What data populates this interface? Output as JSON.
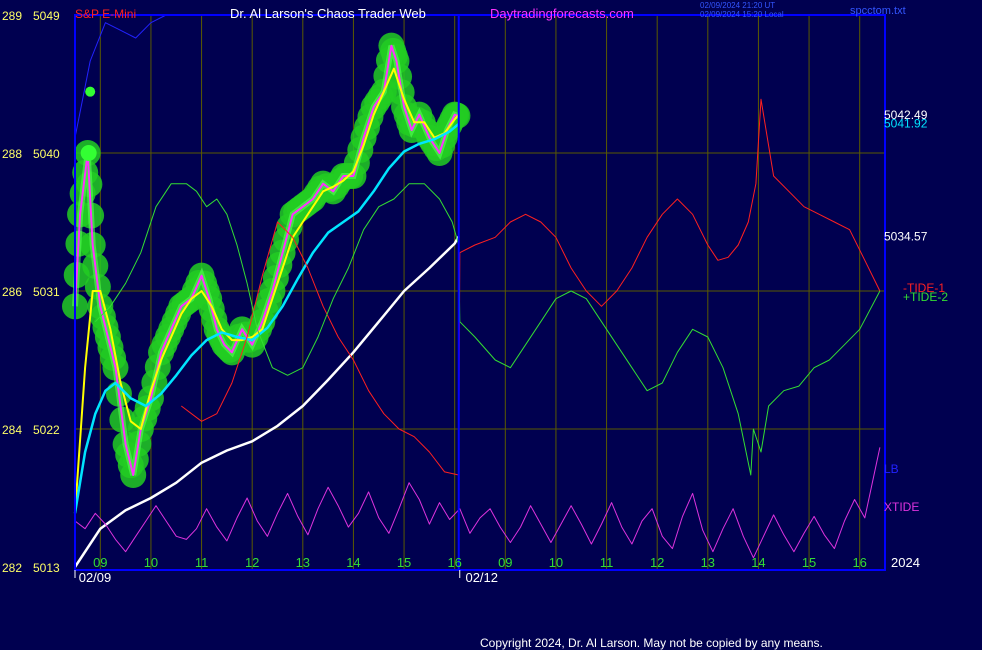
{
  "header": {
    "symbol": "S&P E-Mini",
    "author": "Dr. Al Larson's Chaos Trader Web",
    "site": "Daytradingforecasts.com",
    "stamp_utc": "02/09/2024 21:20 UT",
    "stamp_local": "02/09/2024 15:20 Local",
    "file": "spcctom.txt"
  },
  "footer": {
    "copyright": "Copyright 2024, Dr. Al Larson. May not be copied by any means."
  },
  "colors": {
    "background": "#000050",
    "frame": "#0000ff",
    "grid": "#5a5a00",
    "price": "#ff33ff",
    "fast_ma": "#ffff00",
    "mid_ma": "#00e5ff",
    "slow_ma": "#ffffff",
    "tide1": "#ff2020",
    "tide2": "#33dd33",
    "lb": "#2222ff",
    "xtide": "#dd33dd",
    "halo": "#22cc22"
  },
  "chart_data": {
    "type": "line",
    "y_axis": {
      "ylim": [
        5013,
        5049
      ],
      "ticks": [
        {
          "value": 5049,
          "label_left": "289",
          "label": "5049"
        },
        {
          "value": 5040,
          "label_left": "288",
          "label": "5040"
        },
        {
          "value": 5031,
          "label_left": "286",
          "label": "5031"
        },
        {
          "value": 5022,
          "label_left": "284",
          "label": "5022"
        },
        {
          "value": 5013,
          "label_left": "282",
          "label": "5013"
        }
      ]
    },
    "x_axis": {
      "range_hours": [
        8.5,
        24.5
      ],
      "hour_ticks": [
        {
          "x": 9,
          "label": "09"
        },
        {
          "x": 10,
          "label": "10"
        },
        {
          "x": 11,
          "label": "11"
        },
        {
          "x": 12,
          "label": "12"
        },
        {
          "x": 13,
          "label": "13"
        },
        {
          "x": 14,
          "label": "14"
        },
        {
          "x": 15,
          "label": "15"
        },
        {
          "x": 16,
          "label": "16"
        },
        {
          "x": 17,
          "label": "09"
        },
        {
          "x": 18,
          "label": "10"
        },
        {
          "x": 19,
          "label": "11"
        },
        {
          "x": 20,
          "label": "12"
        },
        {
          "x": 21,
          "label": "13"
        },
        {
          "x": 22,
          "label": "14"
        },
        {
          "x": 23,
          "label": "15"
        },
        {
          "x": 24,
          "label": "16"
        }
      ],
      "date_labels": [
        {
          "x": 8.5,
          "label": "02/09"
        },
        {
          "x": 16.1,
          "label": "02/12"
        }
      ],
      "year_label": "2024",
      "now_x": 16.08
    },
    "right_labels": [
      {
        "text": "5042.49",
        "value": 5042.49,
        "color": "#ffffff"
      },
      {
        "text": "5041.92",
        "value": 5041.92,
        "color": "#00e5ff"
      },
      {
        "text": "5034.57",
        "value": 5034.57,
        "color": "#ffffff"
      },
      {
        "text": "-TIDE-1",
        "value": 5031.2,
        "color": "#ff2020"
      },
      {
        "text": "+TIDE-2",
        "value": 5030.6,
        "color": "#33dd33"
      },
      {
        "text": "LB",
        "value": 5019.4,
        "color": "#2222ff"
      },
      {
        "text": "XTIDE",
        "value": 5016.9,
        "color": "#dd33dd"
      }
    ],
    "series": [
      {
        "name": "S&P E-Mini",
        "kind": "price",
        "x": [
          8.5,
          8.6,
          8.75,
          8.85,
          9.0,
          9.15,
          9.3,
          9.5,
          9.65,
          9.8,
          10.0,
          10.2,
          10.4,
          10.6,
          10.8,
          11.0,
          11.15,
          11.3,
          11.45,
          11.6,
          11.8,
          12.0,
          12.2,
          12.4,
          12.6,
          12.8,
          13.0,
          13.2,
          13.4,
          13.6,
          13.8,
          14.0,
          14.2,
          14.4,
          14.6,
          14.75,
          14.85,
          15.0,
          15.15,
          15.3,
          15.5,
          15.7,
          15.85,
          16.0,
          16.08
        ],
        "y": [
          5030,
          5036,
          5040,
          5034,
          5030,
          5028,
          5026,
          5021,
          5019,
          5022,
          5024,
          5027,
          5028.5,
          5030,
          5030.5,
          5032,
          5030.5,
          5028.5,
          5027.5,
          5027,
          5028.5,
          5027.5,
          5029,
          5031,
          5033.5,
          5036,
          5036.5,
          5037,
          5038,
          5037.5,
          5038.5,
          5038.5,
          5041,
          5043,
          5044,
          5047,
          5046,
          5043,
          5041.5,
          5042.5,
          5041,
          5040,
          5041.5,
          5042.5,
          5042.4
        ]
      },
      {
        "name": "",
        "kind": "fast_ma",
        "x": [
          8.5,
          8.7,
          8.85,
          9.0,
          9.2,
          9.4,
          9.6,
          9.8,
          10.0,
          10.2,
          10.4,
          10.6,
          10.8,
          11.0,
          11.2,
          11.4,
          11.6,
          11.8,
          12.0,
          12.2,
          12.4,
          12.6,
          12.8,
          13.0,
          13.2,
          13.4,
          13.6,
          13.8,
          14.0,
          14.2,
          14.4,
          14.6,
          14.8,
          15.0,
          15.2,
          15.4,
          15.6,
          15.8,
          16.0,
          16.08
        ],
        "y": [
          5016.5,
          5026,
          5031,
          5031,
          5028.5,
          5025,
          5022.5,
          5022,
          5024.5,
          5026.5,
          5028,
          5029.5,
          5030.5,
          5031,
          5030,
          5028.5,
          5027.8,
          5027.8,
          5028,
          5028.5,
          5030.5,
          5032.5,
          5034.5,
          5035.5,
          5036.5,
          5037.5,
          5037.8,
          5038.2,
          5038.8,
          5040.5,
          5042.5,
          5044,
          5045.5,
          5043.5,
          5042,
          5042,
          5041,
          5041.3,
          5042.2,
          5042.5
        ]
      },
      {
        "name": "",
        "kind": "mid_ma",
        "x": [
          8.5,
          8.7,
          8.9,
          9.1,
          9.3,
          9.6,
          9.9,
          10.2,
          10.5,
          10.8,
          11.1,
          11.4,
          11.7,
          12.0,
          12.3,
          12.6,
          12.9,
          13.2,
          13.5,
          13.8,
          14.1,
          14.4,
          14.7,
          15.0,
          15.3,
          15.6,
          15.9,
          16.08
        ],
        "y": [
          5016.5,
          5020.5,
          5023,
          5024.5,
          5025,
          5024,
          5023.5,
          5024.3,
          5025.5,
          5026.8,
          5027.8,
          5028.3,
          5028,
          5027.8,
          5028.6,
          5030,
          5031.8,
          5033.5,
          5034.8,
          5035.5,
          5036.2,
          5037.5,
          5039,
          5040.1,
          5040.6,
          5040.9,
          5041.4,
          5041.9
        ]
      },
      {
        "name": "",
        "kind": "slow_ma",
        "x": [
          8.5,
          9.0,
          9.5,
          10.0,
          10.5,
          11.0,
          11.5,
          12.0,
          12.5,
          13.0,
          13.5,
          14.0,
          14.5,
          15.0,
          15.5,
          16.0,
          16.08
        ],
        "y": [
          5013,
          5015.5,
          5016.7,
          5017.5,
          5018.5,
          5019.8,
          5020.6,
          5021.2,
          5022.2,
          5023.5,
          5025.2,
          5027,
          5029,
          5031,
          5032.5,
          5034.1,
          5034.57
        ]
      },
      {
        "name": "-TIDE-1",
        "kind": "tide1",
        "x": [
          10.6,
          11.0,
          11.3,
          11.6,
          11.9,
          12.2,
          12.5,
          12.8,
          13.1,
          13.4,
          13.7,
          14.0,
          14.3,
          14.6,
          14.9,
          15.2,
          15.5,
          15.8,
          16.08,
          16.1,
          16.4,
          16.8,
          17.1,
          17.4,
          17.7,
          18.0,
          18.3,
          18.6,
          18.9,
          19.2,
          19.5,
          19.8,
          20.1,
          20.4,
          20.7,
          21.0,
          21.2,
          21.4,
          21.6,
          21.8,
          21.95,
          22.05,
          22.3,
          22.6,
          22.9,
          23.2,
          23.5,
          23.8,
          24.1,
          24.4
        ],
        "y": [
          5023.5,
          5022.5,
          5023,
          5025,
          5028,
          5032,
          5035.5,
          5034.5,
          5032.5,
          5030,
          5028,
          5026.5,
          5024.5,
          5023,
          5022,
          5021.5,
          5020.5,
          5019.2,
          5019,
          5033.5,
          5034,
          5034.5,
          5035.5,
          5036,
          5035.5,
          5034.5,
          5032.5,
          5031,
          5030,
          5031,
          5032.5,
          5034.5,
          5036,
          5037,
          5036,
          5034,
          5033,
          5033.2,
          5034,
          5035.5,
          5038,
          5043.5,
          5038.5,
          5037.5,
          5036.5,
          5036,
          5035.5,
          5035,
          5033,
          5031
        ]
      },
      {
        "name": "+TIDE-2",
        "kind": "tide2",
        "x": [
          8.9,
          9.2,
          9.5,
          9.8,
          10.1,
          10.4,
          10.7,
          10.9,
          11.1,
          11.3,
          11.5,
          11.7,
          11.9,
          12.1,
          12.4,
          12.7,
          13.0,
          13.3,
          13.6,
          13.9,
          14.2,
          14.5,
          14.8,
          15.1,
          15.4,
          15.7,
          15.95,
          16.08,
          16.1,
          16.4,
          16.8,
          17.1,
          17.4,
          17.7,
          18.0,
          18.3,
          18.6,
          18.9,
          19.2,
          19.5,
          19.8,
          20.1,
          20.4,
          20.7,
          21.0,
          21.3,
          21.6,
          21.85,
          21.9,
          22.05,
          22.2,
          22.5,
          22.8,
          23.1,
          23.4,
          23.7,
          24.0,
          24.4
        ],
        "y": [
          5029,
          5030,
          5031.5,
          5033.5,
          5036.5,
          5038,
          5038,
          5037.5,
          5036.5,
          5037,
          5036,
          5034,
          5031.5,
          5028.5,
          5026,
          5025.5,
          5026,
          5028,
          5030.5,
          5032.5,
          5035,
          5036.5,
          5037,
          5038,
          5038,
          5037,
          5035.5,
          5034,
          5029,
          5028,
          5026.5,
          5026,
          5027.5,
          5029,
          5030.5,
          5031,
          5030.5,
          5029,
          5027.5,
          5026,
          5024.5,
          5025,
          5027,
          5028.5,
          5028,
          5026,
          5023,
          5019,
          5022,
          5020.5,
          5023.5,
          5024.5,
          5024.8,
          5026,
          5026.5,
          5027.5,
          5028.5,
          5031
        ]
      },
      {
        "name": "LB",
        "kind": "lb",
        "x": [
          8.5,
          8.8,
          9.1,
          9.4,
          9.7,
          10.0,
          10.3,
          10.6,
          10.9,
          11.2,
          11.5,
          11.8,
          12.1,
          12.4,
          12.7,
          13.0,
          13.3,
          13.6,
          13.9,
          14.2,
          14.5,
          14.8,
          15.1,
          15.4,
          15.7,
          16.0,
          16.08
        ],
        "y": [
          5041,
          5046,
          5048.5,
          5048,
          5047.5,
          5048.5,
          5049.5,
          5050.5,
          5051,
          5051,
          5051,
          5051,
          5051,
          5051,
          5051,
          5051,
          5051,
          5051,
          5051,
          5051,
          5051,
          5051,
          5051,
          5051,
          5051,
          5051,
          5051
        ]
      },
      {
        "name": "XTIDE",
        "kind": "xtide",
        "x": [
          8.5,
          8.7,
          8.9,
          9.1,
          9.3,
          9.5,
          9.7,
          9.9,
          10.1,
          10.3,
          10.5,
          10.7,
          10.9,
          11.1,
          11.3,
          11.5,
          11.7,
          11.9,
          12.1,
          12.3,
          12.5,
          12.7,
          12.9,
          13.1,
          13.3,
          13.5,
          13.7,
          13.9,
          14.1,
          14.3,
          14.5,
          14.7,
          14.9,
          15.1,
          15.3,
          15.5,
          15.7,
          15.9,
          16.1,
          16.3,
          16.5,
          16.7,
          16.9,
          17.1,
          17.3,
          17.5,
          17.7,
          17.9,
          18.1,
          18.3,
          18.5,
          18.7,
          18.9,
          19.1,
          19.3,
          19.5,
          19.7,
          19.9,
          20.1,
          20.3,
          20.5,
          20.7,
          20.9,
          21.1,
          21.3,
          21.5,
          21.7,
          21.9,
          22.1,
          22.3,
          22.5,
          22.7,
          22.9,
          23.1,
          23.3,
          23.5,
          23.7,
          23.9,
          24.1,
          24.4
        ],
        "y": [
          5016,
          5015.5,
          5016.5,
          5015.8,
          5014.8,
          5014,
          5015,
          5016,
          5017,
          5016,
          5015,
          5014.8,
          5015.5,
          5016.8,
          5015.6,
          5014.7,
          5016.2,
          5017.5,
          5016,
          5015,
          5016.5,
          5017.8,
          5016.3,
          5015.1,
          5016.8,
          5018.2,
          5017,
          5015.6,
          5016.5,
          5017.9,
          5016.2,
          5015.2,
          5016.8,
          5018.5,
          5017.4,
          5015.8,
          5017.2,
          5016.1,
          5016.8,
          5015.2,
          5016.2,
          5016.8,
          5015.6,
          5014.6,
          5015.6,
          5017,
          5015.8,
          5014.6,
          5015.8,
          5017,
          5015.8,
          5014.5,
          5015.8,
          5017.2,
          5015.6,
          5014.5,
          5016,
          5016.8,
          5015,
          5014.2,
          5016.3,
          5017.8,
          5015.4,
          5014,
          5015.5,
          5016.8,
          5015,
          5013.6,
          5015,
          5016.4,
          5015.1,
          5014,
          5015.2,
          5016.3,
          5015.1,
          5014.2,
          5016,
          5017.4,
          5016.2,
          5020.8
        ]
      }
    ]
  }
}
